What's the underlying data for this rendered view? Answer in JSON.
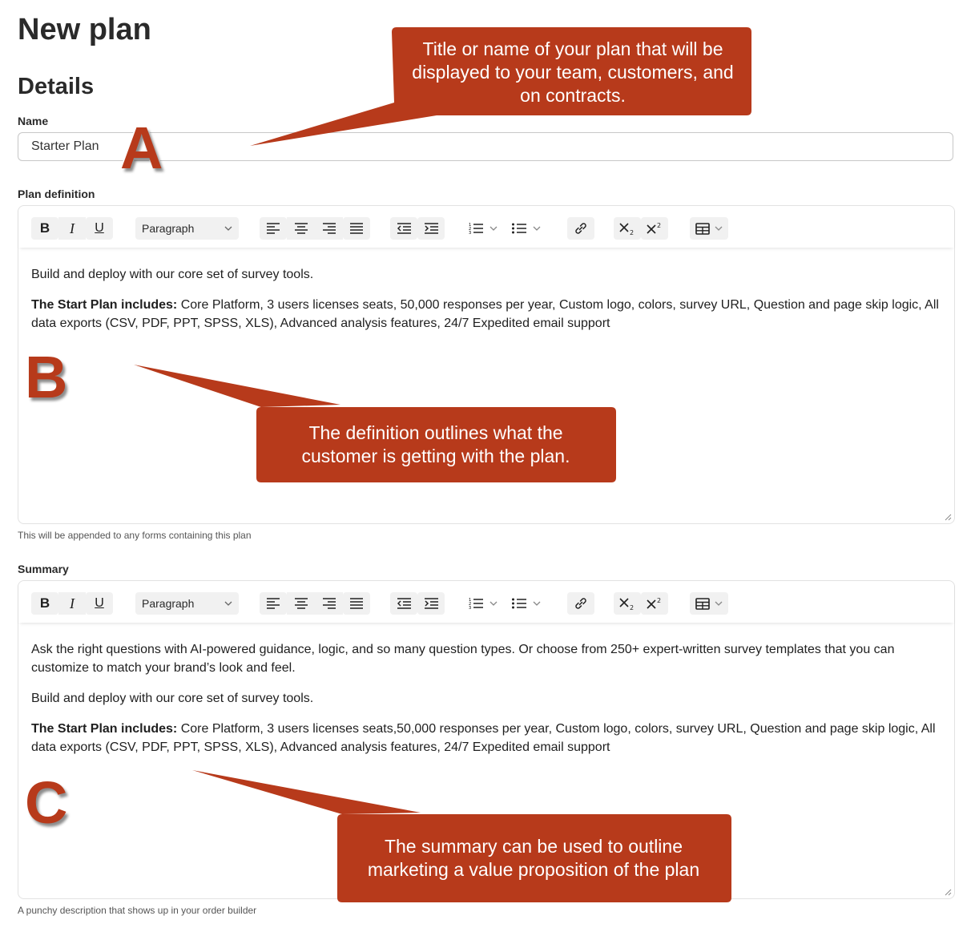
{
  "page": {
    "title": "New plan",
    "section": "Details"
  },
  "name_field": {
    "label": "Name",
    "value": "Starter Plan"
  },
  "definition_field": {
    "label": "Plan definition",
    "helper": "This will be appended to any forms containing this plan",
    "paragraphs": [
      {
        "bold": "",
        "text": "Build and deploy with our core set of survey tools."
      },
      {
        "bold": "The Start Plan includes:",
        "text": " Core Platform, 3 users licenses seats, 50,000 responses per year, Custom logo, colors, survey URL, Question and page skip logic, All data exports (CSV, PDF, PPT, SPSS, XLS), Advanced analysis features, 24/7 Expedited email support"
      }
    ]
  },
  "summary_field": {
    "label": "Summary",
    "helper": "A punchy description that shows up in your order builder",
    "paragraphs": [
      {
        "bold": "",
        "text": "Ask the right questions with AI-powered guidance, logic, and so many question types. Or choose from 250+ expert-written survey templates that you can customize to match your brand’s look and feel."
      },
      {
        "bold": "",
        "text": "Build and deploy with our core set of survey tools."
      },
      {
        "bold": "The Start Plan includes:",
        "text": " Core Platform, 3 users licenses seats,50,000 responses per year, Custom logo, colors, survey URL, Question and page skip logic, All data exports (CSV, PDF, PPT, SPSS, XLS), Advanced analysis features, 24/7 Expedited email support"
      }
    ]
  },
  "toolbar": {
    "bold": "B",
    "italic": "I",
    "underline": "U",
    "block_format": "Paragraph",
    "icons": [
      "bold-icon",
      "italic-icon",
      "underline-icon",
      "chevron-down-icon",
      "align-left-icon",
      "align-center-icon",
      "align-right-icon",
      "align-justify-icon",
      "outdent-icon",
      "indent-icon",
      "numbered-list-icon",
      "bullet-list-icon",
      "link-icon",
      "subscript-icon",
      "superscript-icon",
      "table-icon"
    ]
  },
  "annotations": {
    "a": {
      "letter": "A",
      "text": "Title or name of your plan that will be displayed to your team, customers, and on contracts."
    },
    "b": {
      "letter": "B",
      "text": "The definition outlines what the customer is getting with the plan."
    },
    "c": {
      "letter": "C",
      "text": "The summary can be used to outline marketing a value proposition of the plan"
    }
  },
  "colors": {
    "callout": "#b73a1b",
    "toolbar_button": "#f1f1f1",
    "border": "#c7c7c7",
    "text": "#1f1f1f"
  }
}
